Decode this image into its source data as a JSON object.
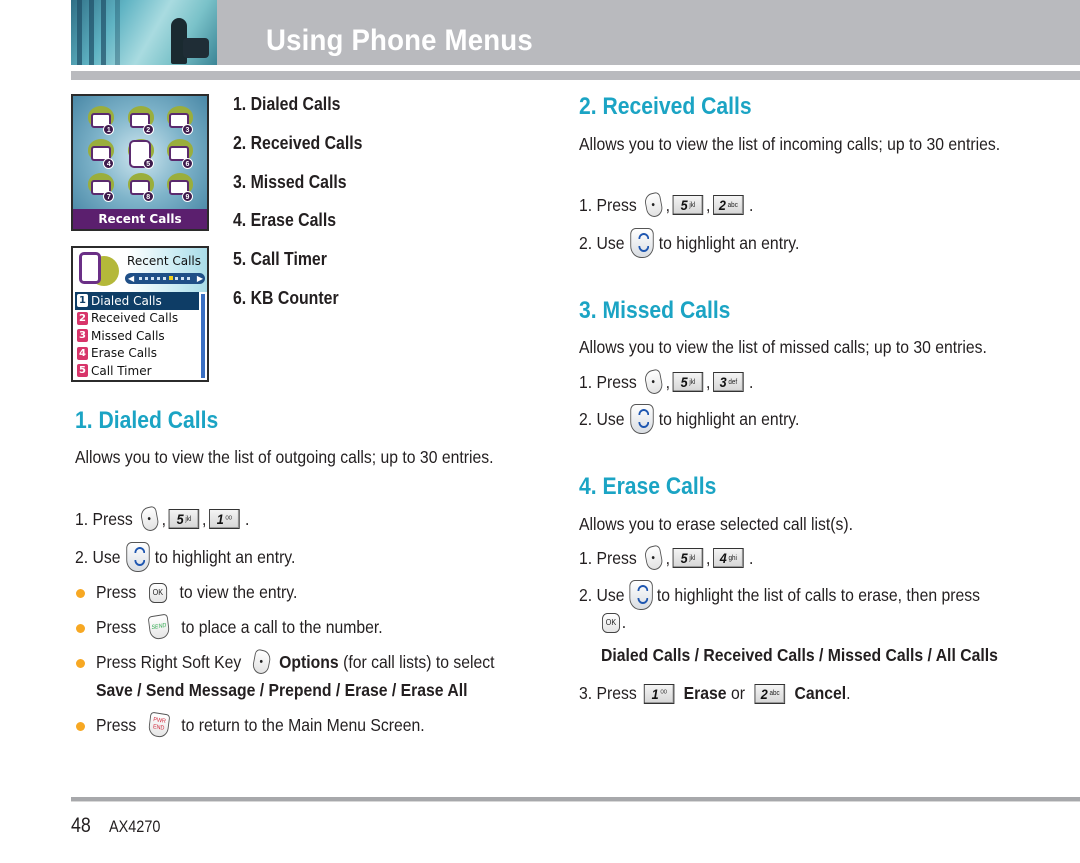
{
  "header": {
    "title": "Using Phone Menus"
  },
  "screens": {
    "main_menu": {
      "label": "Recent Calls",
      "icon_numbers": [
        "1",
        "2",
        "3",
        "4",
        "5",
        "6",
        "7",
        "8",
        "9"
      ],
      "icons": [
        "messaging-icon",
        "media-icon",
        "browser-icon",
        "contacts-icon",
        "recent-calls-icon",
        "music-icon",
        "tools-icon",
        "settings-icon",
        "phone-info-icon"
      ]
    },
    "submenu": {
      "title": "Recent Calls",
      "nav_left": "◀",
      "nav_right": "▶",
      "items": [
        {
          "num": "1",
          "label": "Dialed Calls",
          "active": true
        },
        {
          "num": "2",
          "label": "Received Calls"
        },
        {
          "num": "3",
          "label": "Missed Calls"
        },
        {
          "num": "4",
          "label": "Erase Calls"
        },
        {
          "num": "5",
          "label": "Call Timer"
        }
      ]
    }
  },
  "menu_list": [
    "1. Dialed Calls",
    "2. Received Calls",
    "3. Missed Calls",
    "4. Erase Calls",
    "5. Call Timer",
    "6. KB Counter"
  ],
  "keys": {
    "k1": {
      "digit": "1",
      "sub": "ᴼᴼ"
    },
    "k2": {
      "digit": "2",
      "sub": "abc"
    },
    "k3": {
      "digit": "3",
      "sub": "def"
    },
    "k4": {
      "digit": "4",
      "sub": "ghi"
    },
    "k5": {
      "digit": "5",
      "sub": "jkl"
    },
    "ok": "OK",
    "send": "SEND",
    "end_top": "PWR",
    "end_bottom": "END"
  },
  "sections": {
    "dialed": {
      "heading": "1. Dialed Calls",
      "desc": "Allows you to view the list of outgoing calls; up to 30 entries.",
      "step1_prefix": "1. Press",
      "comma": ",",
      "period": ".",
      "step2_prefix": "2.  Use",
      "step2_suffix": "to highlight an entry.",
      "bullets": {
        "view_prefix": "Press",
        "view_suffix": "to view the entry.",
        "call_prefix": "Press",
        "call_suffix": "to place a call to the number.",
        "options_prefix": "Press Right Soft Key",
        "options_bold": "Options",
        "options_suffix": "(for call lists) to select",
        "options_list": "Save / Send Message / Prepend / Erase / Erase All",
        "return_prefix": "Press",
        "return_suffix": "to return to the Main Menu Screen."
      }
    },
    "received": {
      "heading": "2. Received Calls",
      "desc": "Allows you to view the list of incoming calls; up to 30 entries.",
      "step1_prefix": "1. Press",
      "step2_prefix": "2.  Use",
      "step2_suffix": "to highlight an entry."
    },
    "missed": {
      "heading": "3. Missed Calls",
      "desc": "Allows you to view the list of missed calls; up to 30 entries.",
      "step1_prefix": "1. Press",
      "step2_prefix": "2.  Use",
      "step2_suffix": "to highlight an entry."
    },
    "erase": {
      "heading": "4. Erase Calls",
      "desc": "Allows you to erase selected call list(s).",
      "step1_prefix": "1. Press",
      "step2_prefix": "2. Use",
      "step2_suffix": "to highlight the list of calls to erase, then press",
      "options_list": "Dialed Calls / Received Calls / Missed Calls / All Calls",
      "step3_prefix": "3. Press",
      "step3_erase": "Erase",
      "step3_or": "or",
      "step3_cancel": "Cancel"
    }
  },
  "footer": {
    "page": "48",
    "model": "AX4270"
  },
  "colors": {
    "heading": "#1ba4c4",
    "bullet": "#f7a823",
    "band": "#b9babe"
  }
}
